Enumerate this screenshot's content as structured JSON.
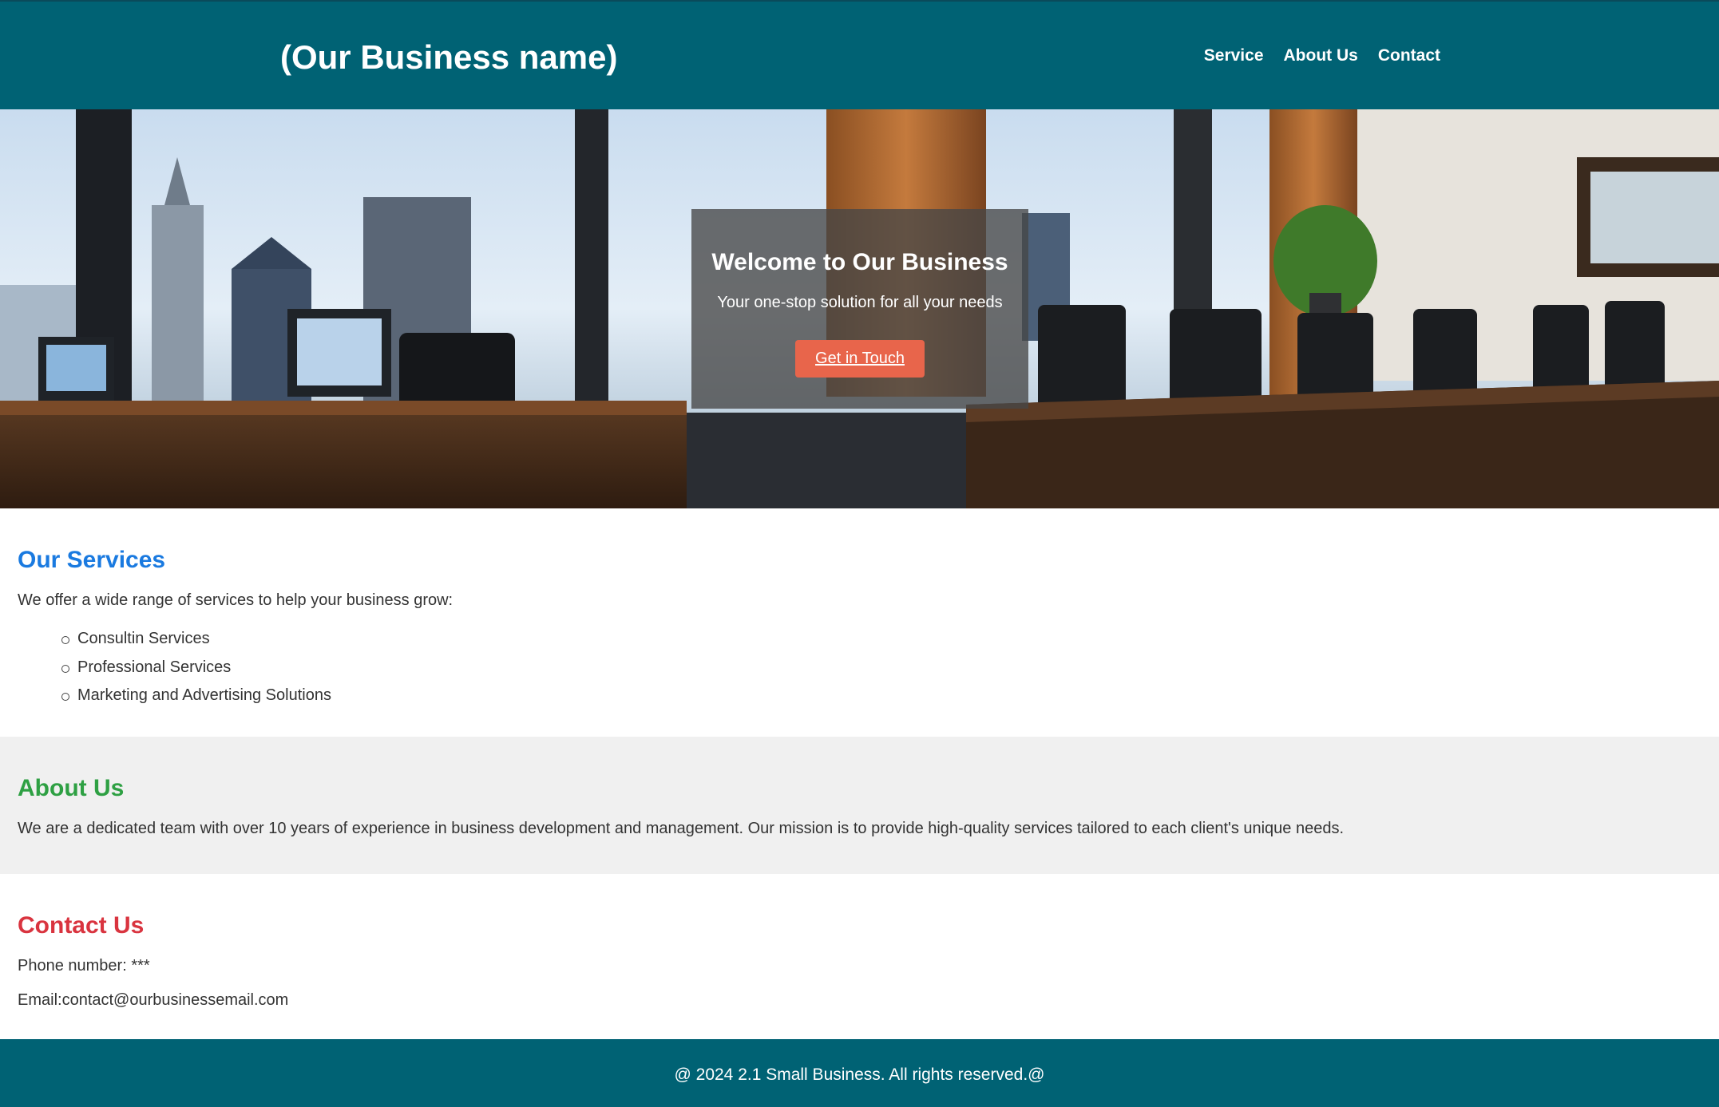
{
  "header": {
    "brand": "(Our Business name)",
    "nav": [
      "Service",
      "About Us",
      "Contact"
    ]
  },
  "hero": {
    "title": "Welcome to Our Business",
    "subtitle": "Your one-stop solution for all your needs",
    "cta_label": "Get in Touch"
  },
  "services": {
    "heading": "Our Services",
    "intro": "We offer a wide range of services to help your business grow:",
    "items": [
      "Consultin Services",
      "Professional Services",
      "Marketing and Advertising Solutions"
    ]
  },
  "about": {
    "heading": "About Us",
    "text": "We are a dedicated team with over 10 years of experience in business development and management. Our mission is to provide high-quality services tailored to each client's unique needs."
  },
  "contact": {
    "heading": "Contact Us",
    "phone": "Phone number: ***",
    "email": "Email:contact@ourbusinessemail.com"
  },
  "footer": {
    "text": "@ 2024 2.1 Small Business. All rights reserved.@"
  },
  "colors": {
    "header_bg": "#006274",
    "cta": "#e8654b",
    "services_heading": "#1a7ae0",
    "about_heading": "#2ea043",
    "contact_heading": "#d9343f"
  }
}
